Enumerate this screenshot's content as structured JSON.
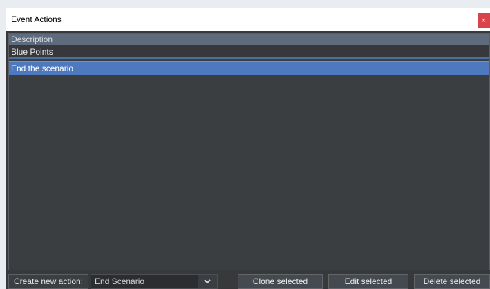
{
  "window": {
    "title": "Event Actions",
    "close_glyph": "×"
  },
  "list": {
    "column_header": "Description",
    "group_label": "Blue Points",
    "items": [
      {
        "label": "End the scenario",
        "selected": true
      }
    ]
  },
  "footer": {
    "create_label": "Create new action:",
    "dropdown_value": "End Scenario",
    "clone_button": "Clone selected",
    "edit_button": "Edit selected",
    "delete_button": "Delete selected"
  },
  "colors": {
    "selection": "#4f79be",
    "header": "#5e6b7c",
    "close": "#d9444a",
    "panel": "#3b3e41"
  },
  "icons": {
    "close": "close-icon",
    "dropdown": "chevron-down-icon"
  }
}
